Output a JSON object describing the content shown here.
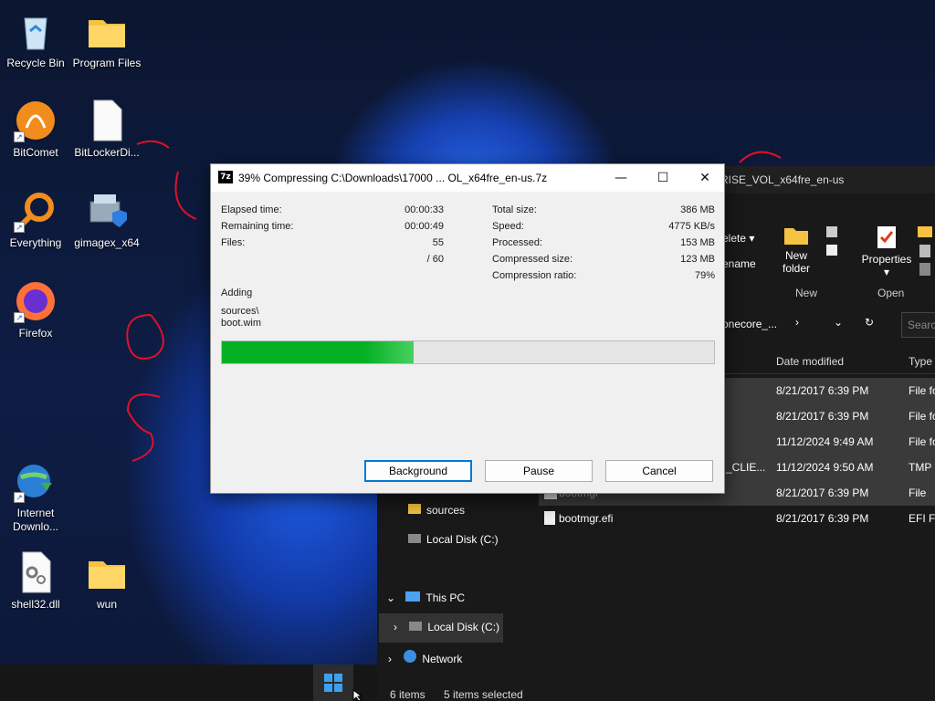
{
  "desktop": {
    "icons": [
      {
        "label": "Recycle Bin"
      },
      {
        "label": "Program Files"
      },
      {
        "label": "BitComet"
      },
      {
        "label": "BitLockerDi..."
      },
      {
        "label": "Everything"
      },
      {
        "label": "gimagex_x64"
      },
      {
        "label": "Firefox"
      },
      {
        "label": "Internet Downlo..."
      },
      {
        "label": "shell32.dll"
      },
      {
        "label": "wun"
      }
    ]
  },
  "dialog": {
    "title": "39% Compressing C:\\Downloads\\17000 ... OL_x64fre_en-us.7z",
    "app_icon": "7z",
    "stats_left": [
      {
        "label": "Elapsed time:",
        "value": "00:00:33"
      },
      {
        "label": "Remaining time:",
        "value": "00:00:49"
      },
      {
        "label": "Files:",
        "value": "55"
      },
      {
        "label": "",
        "value": "/ 60"
      }
    ],
    "stats_right": [
      {
        "label": "Total size:",
        "value": "386 MB"
      },
      {
        "label": "Speed:",
        "value": "4775 KB/s"
      },
      {
        "label": "Processed:",
        "value": "153 MB"
      },
      {
        "label": "Compressed size:",
        "value": "123 MB"
      },
      {
        "label": "Compression ratio:",
        "value": "79%"
      }
    ],
    "status_label": "Adding",
    "current_path": "sources\\",
    "current_file": "boot.wim",
    "progress_fraction": 0.39,
    "buttons": {
      "background": "Background",
      "pause": "Pause",
      "cancel": "Cancel"
    }
  },
  "explorer": {
    "title_fragment": "RISE_VOL_x64fre_en-us",
    "ribbon": {
      "delete": "elete",
      "rename": "ename",
      "new_folder_line1": "New",
      "new_folder_line2": "folder",
      "new_group": "New",
      "properties": "Properties",
      "open_group": "Open"
    },
    "breadcrumb": "onecore_...",
    "search_placeholder": "Search",
    "columns": {
      "date": "Date modified",
      "type": "Type"
    },
    "rows": [
      {
        "name": "",
        "date": "8/21/2017 6:39 PM",
        "type": "File fo",
        "selected": true
      },
      {
        "name": "",
        "date": "8/21/2017 6:39 PM",
        "type": "File fo",
        "selected": true
      },
      {
        "name": "",
        "date": "11/12/2024 9:49 AM",
        "type": "File fo",
        "selected": true
      },
      {
        "name": "_CLIE...",
        "date": "11/12/2024 9:50 AM",
        "type": "TMP",
        "selected": true
      },
      {
        "name": "bootmgr",
        "date": "8/21/2017 6:39 PM",
        "type": "File",
        "selected": true
      },
      {
        "name": "bootmgr.efi",
        "date": "8/21/2017 6:39 PM",
        "type": "EFI Fil",
        "selected": false
      }
    ],
    "nav": {
      "sources": "sources",
      "local_disk_1": "Local Disk (C:)",
      "this_pc": "This PC",
      "local_disk_2": "Local Disk (C:)",
      "network": "Network"
    },
    "status": {
      "items": "6 items",
      "selected": "5 items selected"
    }
  },
  "colors": {
    "progress": "#06b025",
    "accent": "#0078d4"
  }
}
